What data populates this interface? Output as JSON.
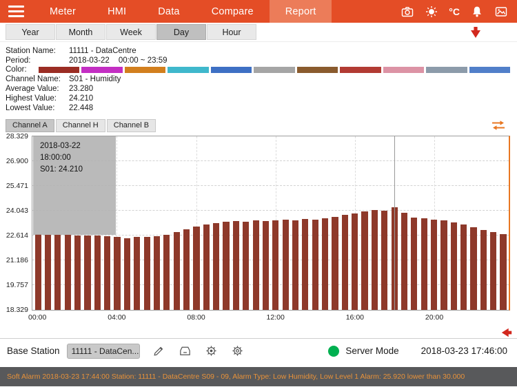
{
  "header": {
    "nav_items": [
      {
        "label": "Meter",
        "active": false
      },
      {
        "label": "HMI",
        "active": false
      },
      {
        "label": "Data",
        "active": false
      },
      {
        "label": "Compare",
        "active": false
      },
      {
        "label": "Report",
        "active": true
      }
    ],
    "celsius_label": "°C",
    "colors": {
      "background": "#E44D26",
      "active_item": "#EC7C59"
    },
    "icons": [
      "menu-icon",
      "camera-icon",
      "brightness-icon",
      "temperature-unit-toggle",
      "alarm-bell-icon",
      "screenshot-icon"
    ]
  },
  "period_tabs": [
    {
      "label": "Year",
      "active": false
    },
    {
      "label": "Month",
      "active": false
    },
    {
      "label": "Week",
      "active": false
    },
    {
      "label": "Day",
      "active": true
    },
    {
      "label": "Hour",
      "active": false
    }
  ],
  "info_panel": {
    "station_label": "Station Name:",
    "station_value": "11111 - DataCentre",
    "period_label": "Period:",
    "period_date": "2018-03-22",
    "period_range": "00:00 ~ 23:59",
    "color_label": "Color:",
    "color_swatches": [
      "#9B2D24",
      "#C32FC3",
      "#D27F1E",
      "#3FB8CC",
      "#3E70C4",
      "#A5A5A5",
      "#8A5B2E",
      "#B23B33",
      "#DC93A5",
      "#8C9BAA",
      "#517FC9"
    ],
    "channel_label": "Channel Name:",
    "channel_value": "S01 - Humidity",
    "average_label": "Average Value:",
    "average_value": "23.280",
    "highest_label": "Highest Value:",
    "highest_value": "24.210",
    "lowest_label": "Lowest Value:",
    "lowest_value": "22.448"
  },
  "channel_tabs": [
    {
      "label": "Channel A",
      "active": true
    },
    {
      "label": "Channel H",
      "active": false
    },
    {
      "label": "Channel B",
      "active": false
    }
  ],
  "chart_data": {
    "type": "bar",
    "title": "",
    "xlabel": "",
    "ylabel": "",
    "x": [
      "00:00",
      "00:30",
      "01:00",
      "01:30",
      "02:00",
      "02:30",
      "03:00",
      "03:30",
      "04:00",
      "04:30",
      "05:00",
      "05:30",
      "06:00",
      "06:30",
      "07:00",
      "07:30",
      "08:00",
      "08:30",
      "09:00",
      "09:30",
      "10:00",
      "10:30",
      "11:00",
      "11:30",
      "12:00",
      "12:30",
      "13:00",
      "13:30",
      "14:00",
      "14:30",
      "15:00",
      "15:30",
      "16:00",
      "16:30",
      "17:00",
      "17:30",
      "18:00",
      "18:30",
      "19:00",
      "19:30",
      "20:00",
      "20:30",
      "21:00",
      "21:30",
      "22:00",
      "22:30",
      "23:00",
      "23:30"
    ],
    "values": [
      22.68,
      22.65,
      22.62,
      22.62,
      22.6,
      22.58,
      22.6,
      22.56,
      22.52,
      22.448,
      22.5,
      22.52,
      22.56,
      22.62,
      22.78,
      22.95,
      23.12,
      23.25,
      23.32,
      23.38,
      23.42,
      23.38,
      23.46,
      23.42,
      23.48,
      23.52,
      23.46,
      23.55,
      23.5,
      23.6,
      23.68,
      23.78,
      23.88,
      23.98,
      24.08,
      24.02,
      24.21,
      23.92,
      23.65,
      23.58,
      23.52,
      23.46,
      23.36,
      23.22,
      23.08,
      22.92,
      22.78,
      22.68
    ],
    "ylim": [
      18.329,
      28.329
    ],
    "ytick_labels": [
      "18.329",
      "19.757",
      "21.186",
      "22.614",
      "24.043",
      "25.471",
      "26.900",
      "28.329"
    ],
    "xtick_labels": [
      "00:00",
      "04:00",
      "08:00",
      "12:00",
      "16:00",
      "20:00"
    ],
    "xtick_every": 8,
    "grid": true,
    "bar_color": "#8E392A",
    "tooltip": {
      "line1": "2018-03-22 18:00:00",
      "line2": "S01: 24.210"
    },
    "crosshair_index": 36
  },
  "footer": {
    "base_station_label": "Base Station",
    "base_station_value": "11111 - DataCen...",
    "server_mode_label": "Server Mode",
    "timestamp": "2018-03-23 17:46:00",
    "status_color": "#00B050",
    "icons": [
      "edit-icon",
      "folder-icon",
      "settings-gear-icon",
      "system-gear-icon"
    ]
  },
  "alarm_bar": {
    "text": "Soft Alarm 2018-03-23 17:44:00 Station: 11111 - DataCentre S09 - 09, Alarm Type: Low Humidity, Low Level 1 Alarm: 25.920 lower than 30.000",
    "text_color": "#E8923A",
    "background": "#58595B"
  }
}
